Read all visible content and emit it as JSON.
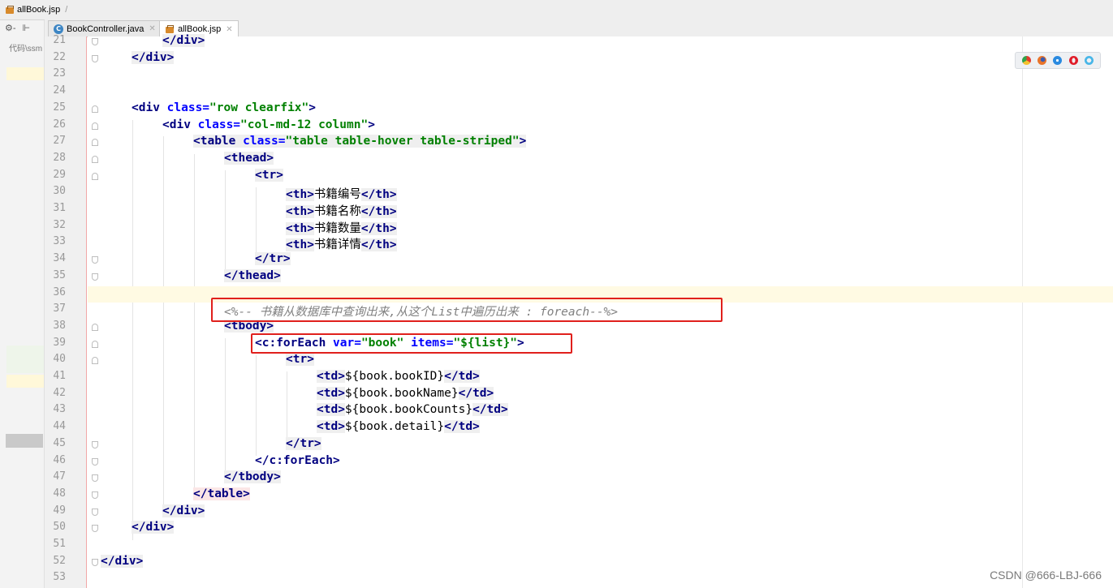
{
  "navbar": {
    "file_crumb": "allBook.jsp",
    "separator": "/"
  },
  "left_pane": {
    "tools": [
      "⚙-",
      "⊩"
    ],
    "path_label": "代码\\ssm"
  },
  "tabs": [
    {
      "label": "BookController.java",
      "icon": "java-class-icon",
      "active": false
    },
    {
      "label": "allBook.jsp",
      "icon": "jsp-file-icon",
      "active": true
    }
  ],
  "code_lines": [
    {
      "n": "21"
    },
    {
      "n": "22"
    },
    {
      "n": "23"
    },
    {
      "n": "24"
    },
    {
      "n": "25"
    },
    {
      "n": "26"
    },
    {
      "n": "27"
    },
    {
      "n": "28"
    },
    {
      "n": "29"
    },
    {
      "n": "30"
    },
    {
      "n": "31"
    },
    {
      "n": "32"
    },
    {
      "n": "33"
    },
    {
      "n": "34"
    },
    {
      "n": "35"
    },
    {
      "n": "36"
    },
    {
      "n": "37"
    },
    {
      "n": "38"
    },
    {
      "n": "39"
    },
    {
      "n": "40"
    },
    {
      "n": "41"
    },
    {
      "n": "42"
    },
    {
      "n": "43"
    },
    {
      "n": "44"
    },
    {
      "n": "45"
    },
    {
      "n": "46"
    },
    {
      "n": "47"
    },
    {
      "n": "48"
    },
    {
      "n": "49"
    },
    {
      "n": "50"
    },
    {
      "n": "51"
    },
    {
      "n": "52"
    },
    {
      "n": "53"
    }
  ],
  "code": {
    "l21": "</div>",
    "l22": "</div>",
    "l25_tag": "<div ",
    "l25_attr": "class=",
    "l25_val": "\"row clearfix\"",
    "l25_end": ">",
    "l26_tag": "<div ",
    "l26_attr": "class=",
    "l26_val": "\"col-md-12 column\"",
    "l26_end": ">",
    "l27_tag": "<table ",
    "l27_attr": "class=",
    "l27_val": "\"table table-hover table-striped\"",
    "l27_end": ">",
    "l28": "<thead>",
    "l29": "<tr>",
    "th_open": "<th>",
    "th_close": "</th>",
    "th1": "书籍编号",
    "th2": "书籍名称",
    "th3": "书籍数量",
    "th4": "书籍详情",
    "l34": "</tr>",
    "l35": "</thead>",
    "l37": "<%-- 书籍从数据库中查询出来,从这个List中遍历出来 : foreach--%>",
    "l38": "<tbody>",
    "l39_tag": "<c:forEach ",
    "l39_attr1": "var=",
    "l39_val1": "\"book\"",
    "l39_attr2": " items=",
    "l39_val2": "\"${list}\"",
    "l39_end": ">",
    "l40": "<tr>",
    "td_open": "<td>",
    "td_close": "</td>",
    "td1": "${book.bookID}",
    "td2": "${book.bookName}",
    "td3": "${book.bookCounts}",
    "td4": "${book.detail}",
    "l45": "</tr>",
    "l46": "</c:forEach>",
    "l47": "</tbody>",
    "l48": "</table>",
    "l49": "</div>",
    "l50": "</div>",
    "l52": "</div>"
  },
  "browser_icons": [
    "chrome-icon",
    "firefox-icon",
    "safari-icon",
    "opera-icon",
    "ie-icon"
  ],
  "colors": {
    "tag": "#000080",
    "attr": "#0000ff",
    "value": "#008000",
    "comment": "#808080",
    "annotation": "#e0201c"
  },
  "watermark": "CSDN @666-LBJ-666"
}
